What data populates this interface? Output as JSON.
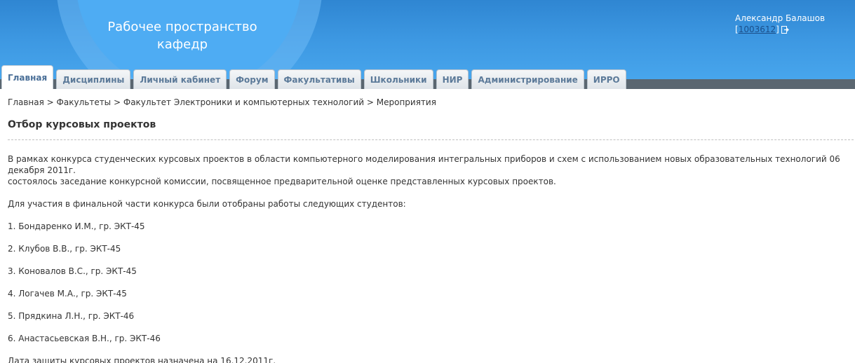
{
  "header": {
    "title_line1": "Рабочее пространство",
    "title_line2": "кафедр",
    "user_name": "Александр Балашов",
    "user_id": "1003612",
    "bracket_open": "[",
    "bracket_close": "]"
  },
  "tabs": [
    {
      "label": "Главная",
      "active": true
    },
    {
      "label": "Дисциплины"
    },
    {
      "label": "Личный кабинет"
    },
    {
      "label": "Форум"
    },
    {
      "label": "Факультативы"
    },
    {
      "label": "Школьники"
    },
    {
      "label": "НИР"
    },
    {
      "label": "Администрирование"
    },
    {
      "label": "ИРРО"
    }
  ],
  "breadcrumb": {
    "items": [
      "Главная",
      "Факультеты",
      "Факультет Электроники и компьютерных технологий",
      "Мероприятия"
    ],
    "separator": ">"
  },
  "article": {
    "title": "Отбор курсовых проектов",
    "intro_line1": "В рамках конкурса студенческих курсовых проектов в области компьютерного моделирования интегральных приборов и схем с использованием новых образовательных технологий 06 декабря 2011г.",
    "intro_line2": "состоялось заседание конкурсной комиссии, посвященное предварительной оценке представленных курсовых проектов.",
    "lead": "Для участия в финальной части конкурса были отобраны работы следующих студентов:",
    "students": [
      "1. Бондаренко И.М., гр. ЭКТ-45",
      "2. Клубов В.В., гр. ЭКТ-45",
      "3. Коновалов В.С., гр. ЭКТ-45",
      "4. Логачев М.А., гр. ЭКТ-45",
      "5. Прядкина Л.Н., гр. ЭКТ-46",
      "6. Анастасьевская В.Н., гр. ЭКТ-46"
    ],
    "footer": "Дата защиты курсовых проектов назначена на 16.12.2011г."
  },
  "colors": {
    "header_blue": "#3d98e2",
    "tab_text": "#5c7a99",
    "link_blue": "#1b4f8a"
  },
  "icons": {
    "logout": "logout-icon"
  }
}
